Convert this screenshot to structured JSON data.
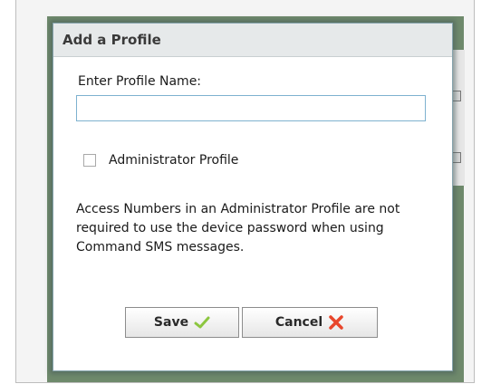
{
  "dialog": {
    "title": "Add a Profile",
    "name_label": "Enter Profile Name:",
    "name_value": "",
    "admin_checkbox_label": "Administrator Profile",
    "admin_checked": false,
    "help_text": "Access Numbers in an Administrator Profile are not required to use the device password when using Command SMS messages.",
    "save_label": "Save",
    "cancel_label": "Cancel"
  },
  "icons": {
    "save": "checkmark-icon",
    "cancel": "x-icon"
  },
  "colors": {
    "save_icon": "#8cc63f",
    "cancel_icon": "#e8462b",
    "input_border": "#7eb2cf"
  }
}
